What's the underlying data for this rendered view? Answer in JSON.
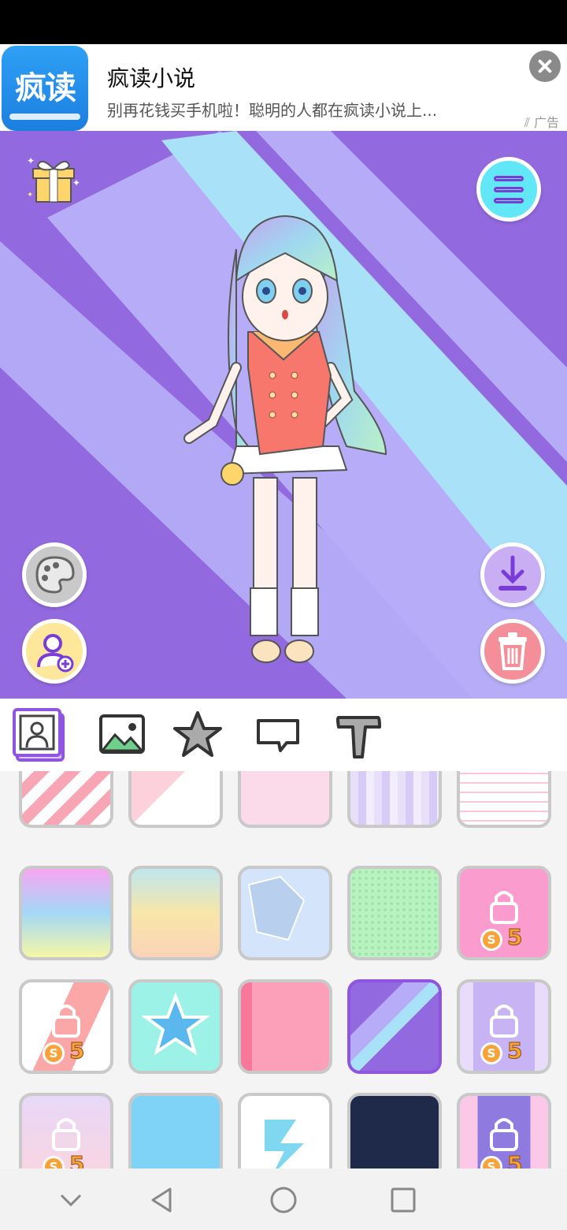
{
  "ad": {
    "logo_text": "疯读",
    "title": "疯读小说",
    "description": "别再花钱买手机啦！聪明的人都在疯读小说上...",
    "tag": "广告"
  },
  "stage": {
    "background": "purple diagonal light rays",
    "character": "anime girl with pastel rainbow hair in a coral sailor dress",
    "buttons": [
      "gift",
      "menu",
      "palette",
      "add-character",
      "download",
      "delete"
    ]
  },
  "toolbar": {
    "tabs": [
      "character-tab",
      "background-tab",
      "sticker-tab",
      "speech-bubble-tab",
      "text-tab"
    ],
    "active": "character-tab"
  },
  "backgrounds": {
    "locked_price": "5",
    "coin_symbol": "S",
    "selected_index": 13
  },
  "colors": {
    "accent": "#8f55e0",
    "stage": "#9369e0",
    "coin": "#f8a23a"
  }
}
